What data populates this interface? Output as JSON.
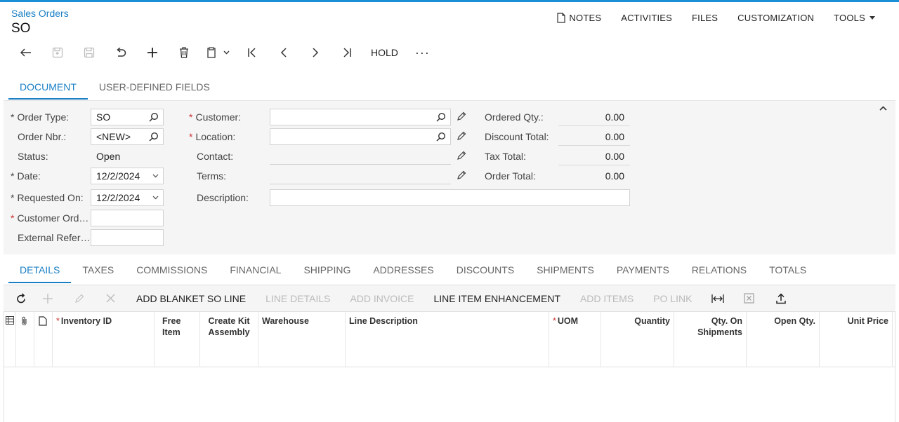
{
  "header": {
    "breadcrumb": "Sales Orders",
    "title": "SO"
  },
  "top_menu": {
    "notes": "NOTES",
    "activities": "ACTIVITIES",
    "files": "FILES",
    "customization": "CUSTOMIZATION",
    "tools": "TOOLS"
  },
  "toolbar": {
    "hold": "HOLD",
    "more": "···"
  },
  "tabs_top": {
    "document": "DOCUMENT",
    "user_defined": "USER-DEFINED FIELDS"
  },
  "form": {
    "order_type_label": "Order Type:",
    "order_type_value": "SO",
    "order_nbr_label": "Order Nbr.:",
    "order_nbr_value": "<NEW>",
    "status_label": "Status:",
    "status_value": "Open",
    "date_label": "Date:",
    "date_value": "12/2/2024",
    "requested_on_label": "Requested On:",
    "requested_on_value": "12/2/2024",
    "customer_ord_label": "Customer Ord…",
    "external_ref_label": "External Refer…",
    "customer_label": "Customer:",
    "location_label": "Location:",
    "contact_label": "Contact:",
    "terms_label": "Terms:",
    "description_label": "Description:",
    "ordered_qty_label": "Ordered Qty.:",
    "ordered_qty_value": "0.00",
    "discount_total_label": "Discount Total:",
    "discount_total_value": "0.00",
    "tax_total_label": "Tax Total:",
    "tax_total_value": "0.00",
    "order_total_label": "Order Total:",
    "order_total_value": "0.00"
  },
  "tabs_bottom": [
    "DETAILS",
    "TAXES",
    "COMMISSIONS",
    "FINANCIAL",
    "SHIPPING",
    "ADDRESSES",
    "DISCOUNTS",
    "SHIPMENTS",
    "PAYMENTS",
    "RELATIONS",
    "TOTALS"
  ],
  "grid_toolbar": {
    "add_blanket": "ADD BLANKET SO LINE",
    "line_details": "LINE DETAILS",
    "add_invoice": "ADD INVOICE",
    "line_item_enh": "LINE ITEM ENHANCEMENT",
    "add_items": "ADD ITEMS",
    "po_link": "PO LINK"
  },
  "grid_columns": {
    "inventory_id": "Inventory ID",
    "free_item": "Free Item",
    "create_kit": "Create Kit Assembly",
    "warehouse": "Warehouse",
    "line_description": "Line Description",
    "uom": "UOM",
    "quantity": "Quantity",
    "qty_on_shipments": "Qty. On Shipments",
    "open_qty": "Open Qty.",
    "unit_price": "Unit Price"
  },
  "colors": {
    "accent": "#1a7fc4",
    "required": "#cc3333"
  }
}
